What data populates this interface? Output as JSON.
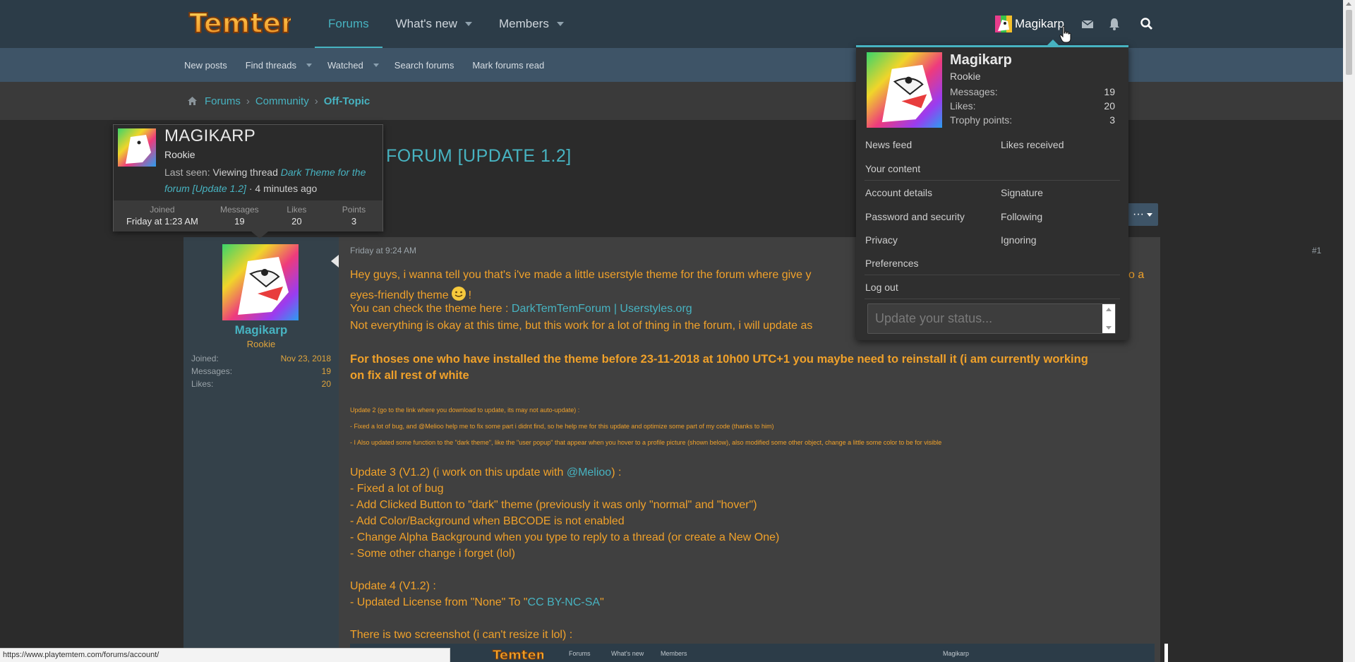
{
  "header": {
    "logo_text": "Temtem",
    "nav": [
      {
        "label": "Forums",
        "active": true
      },
      {
        "label": "What's new",
        "dropdown": true
      },
      {
        "label": "Members",
        "dropdown": true
      }
    ],
    "user": "Magikarp",
    "icons": [
      "envelope-icon",
      "bell-icon",
      "search-icon"
    ]
  },
  "subnav": {
    "items": [
      {
        "label": "New posts"
      },
      {
        "label": "Find threads",
        "dropdown": true
      },
      {
        "label": "Watched",
        "dropdown": true
      },
      {
        "label": "Search forums"
      },
      {
        "label": "Mark forums read"
      }
    ]
  },
  "breadcrumb": [
    "Forums",
    "Community",
    "Off-Topic"
  ],
  "thread": {
    "title_visible": "FORUM [UPDATE 1.2]",
    "more": "···"
  },
  "member_tooltip": {
    "name": "MAGIKARP",
    "title": "Rookie",
    "last_seen_label": "Last seen:",
    "activity": "Viewing thread",
    "thread_link": "Dark Theme for the forum [Update 1.2]",
    "ago": "· 4 minutes ago",
    "stats": [
      {
        "label": "Joined",
        "value": "Friday at 1:23 AM"
      },
      {
        "label": "Messages",
        "value": "19"
      },
      {
        "label": "Likes",
        "value": "20"
      },
      {
        "label": "Points",
        "value": "3"
      }
    ]
  },
  "post": {
    "username": "Magikarp",
    "user_title": "Rookie",
    "user_stats": [
      {
        "label": "Joined:",
        "value": "Nov 23, 2018"
      },
      {
        "label": "Messages:",
        "value": "19"
      },
      {
        "label": "Likes:",
        "value": "20"
      }
    ],
    "date": "Friday at 9:24 AM",
    "number": "#1",
    "line1a": "Hey guys, i wanna tell you that's i've made a little userstyle theme for the forum where give y",
    "line1b": "o a",
    "line2a": "eyes-friendly theme",
    "line2b": "!",
    "line3a": "You can check the theme here :",
    "line3_link": "DarkTemTemForum | Userstyles.org",
    "line4": "Not everything is okay at this time, but this work for a lot of thing in the forum, i will update as",
    "bold1": "For thoses one who have installed the theme before 23-11-2018 at 10h00 UTC+1 you maybe need to reinstall it (i am currently working",
    "bold2": "on fix all rest of white",
    "small1": "Update 2 (go to the link where you download to update, its may not auto-update) :",
    "small2": "- Fixed a lot of bug, and @Melioo help me to fix some part i didnt find, so he help me for this update and optimize some part of my code (thanks to him)",
    "small3": "- I Also updated some function to the \"dark theme\", like the \"user popup\" that appear when you hover to a profile picture (shown below), also modified some other object, change a little some color to be for visible",
    "u3_head_a": "Update 3 (V1.2) (i work on this update with",
    "u3_head_link": "@Melioo",
    "u3_head_b": ") :",
    "u3_items": [
      "- Fixed a lot of bug",
      "- Add Clicked Button to \"dark\" theme (previously it was only \"normal\" and \"hover\")",
      "- Add Color/Background when BBCODE is not enabled",
      "- Change Alpha Background when you type to reply to a thread (or create a New One)",
      "- Some other change i forget (lol)"
    ],
    "u4_head": "Update 4 (V1.2) :",
    "u4_item_a": "- Updated License from \"None\" To \"",
    "u4_item_link": "CC BY-NC-SA",
    "u4_item_b": "\"",
    "screens": "There is two screenshot (i can't resize it lol) :",
    "embed_nav": [
      "Forums",
      "What's new",
      "Members",
      "Magikarp"
    ]
  },
  "account_menu": {
    "name": "Magikarp",
    "title": "Rookie",
    "stats": [
      {
        "label": "Messages:",
        "value": "19"
      },
      {
        "label": "Likes:",
        "value": "20"
      },
      {
        "label": "Trophy points:",
        "value": "3"
      }
    ],
    "links": {
      "news_feed": "News feed",
      "likes_received": "Likes received",
      "your_content": "Your content",
      "account_details": "Account details",
      "signature": "Signature",
      "password_security": "Password and security",
      "following": "Following",
      "privacy": "Privacy",
      "ignoring": "Ignoring",
      "preferences": "Preferences",
      "log_out": "Log out"
    },
    "status_placeholder": "Update your status..."
  },
  "status_url": "https://www.playtemtem.com/forums/account/",
  "colors": {
    "accent": "#47b3c1",
    "post_text": "#f0a12a",
    "header": "#2c3c48",
    "subnav": "#3e5467"
  }
}
